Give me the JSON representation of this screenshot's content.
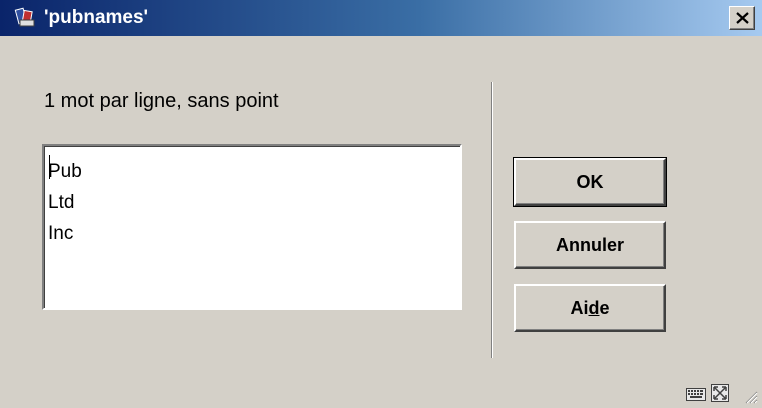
{
  "window": {
    "title": "'pubnames'"
  },
  "form": {
    "instruction": "1 mot par ligne, sans point",
    "lines": [
      "Pub",
      "Ltd",
      "Inc"
    ]
  },
  "buttons": {
    "ok": "OK",
    "cancel": "Annuler",
    "help_prefix": "Ai",
    "help_mnemonic": "d",
    "help_suffix": "e"
  },
  "icons": {
    "app": "books-icon",
    "close": "close-icon",
    "keyboard": "keyboard-icon",
    "expand": "expand-icon",
    "resize": "resize-grip-icon"
  },
  "colors": {
    "titlebar_start": "#0a246a",
    "titlebar_end": "#a6caf0",
    "dialog_face": "#d4d0c8"
  }
}
